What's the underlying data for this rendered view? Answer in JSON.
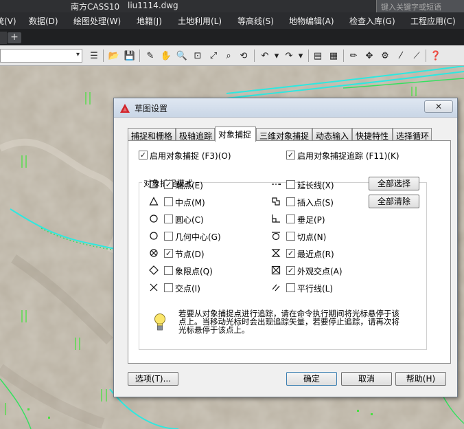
{
  "app": {
    "title": "南方CASS10",
    "file": "liu1114.dwg",
    "search_placeholder": "键入关键字或短语"
  },
  "menu": [
    "统(V)",
    "数据(D)",
    "绘图处理(W)",
    "地籍(J)",
    "土地利用(L)",
    "等高线(S)",
    "地物编辑(A)",
    "检查入库(G)",
    "工程应用(C)"
  ],
  "tab_strip": {
    "add": "+"
  },
  "toolbar": {
    "combo_arrow": "▾"
  },
  "dialog": {
    "title": "草图设置",
    "close": "✕",
    "tabs": [
      "捕捉和栅格",
      "极轴追踪",
      "对象捕捉",
      "三维对象捕捉",
      "动态输入",
      "快捷特性",
      "选择循环"
    ],
    "active_tab": 2,
    "enable_osnap": {
      "label": "启用对象捕捉 (F3)(O)",
      "checked": true
    },
    "enable_tracking": {
      "label": "启用对象捕捉追踪 (F11)(K)",
      "checked": true
    },
    "group_title": "对象捕捉模式",
    "left_modes": [
      {
        "label": "端点(E)",
        "checked": true,
        "icon": "square-icon"
      },
      {
        "label": "中点(M)",
        "checked": false,
        "icon": "triangle-icon"
      },
      {
        "label": "圆心(C)",
        "checked": false,
        "icon": "circle-icon"
      },
      {
        "label": "几何中心(G)",
        "checked": false,
        "icon": "circle-icon"
      },
      {
        "label": "节点(D)",
        "checked": true,
        "icon": "node-icon"
      },
      {
        "label": "象限点(Q)",
        "checked": false,
        "icon": "diamond-icon"
      },
      {
        "label": "交点(I)",
        "checked": false,
        "icon": "cross-icon"
      }
    ],
    "right_modes": [
      {
        "label": "延长线(X)",
        "checked": false,
        "icon": "extension-icon"
      },
      {
        "label": "插入点(S)",
        "checked": false,
        "icon": "insert-icon"
      },
      {
        "label": "垂足(P)",
        "checked": false,
        "icon": "perpendicular-icon"
      },
      {
        "label": "切点(N)",
        "checked": false,
        "icon": "tangent-icon"
      },
      {
        "label": "最近点(R)",
        "checked": true,
        "icon": "nearest-icon"
      },
      {
        "label": "外观交点(A)",
        "checked": true,
        "icon": "apparent-intersection-icon"
      },
      {
        "label": "平行线(L)",
        "checked": false,
        "icon": "parallel-icon"
      }
    ],
    "select_all": "全部选择",
    "clear_all": "全部清除",
    "hint": "若要从对象捕捉点进行追踪，请在命令执行期间将光标悬停于该点上。当移动光标时会出现追踪矢量，若要停止追踪，请再次将光标悬停于该点上。",
    "options_button": "选项(T)...",
    "ok_button": "确定",
    "cancel_button": "取消",
    "help_button": "帮助(H)"
  }
}
